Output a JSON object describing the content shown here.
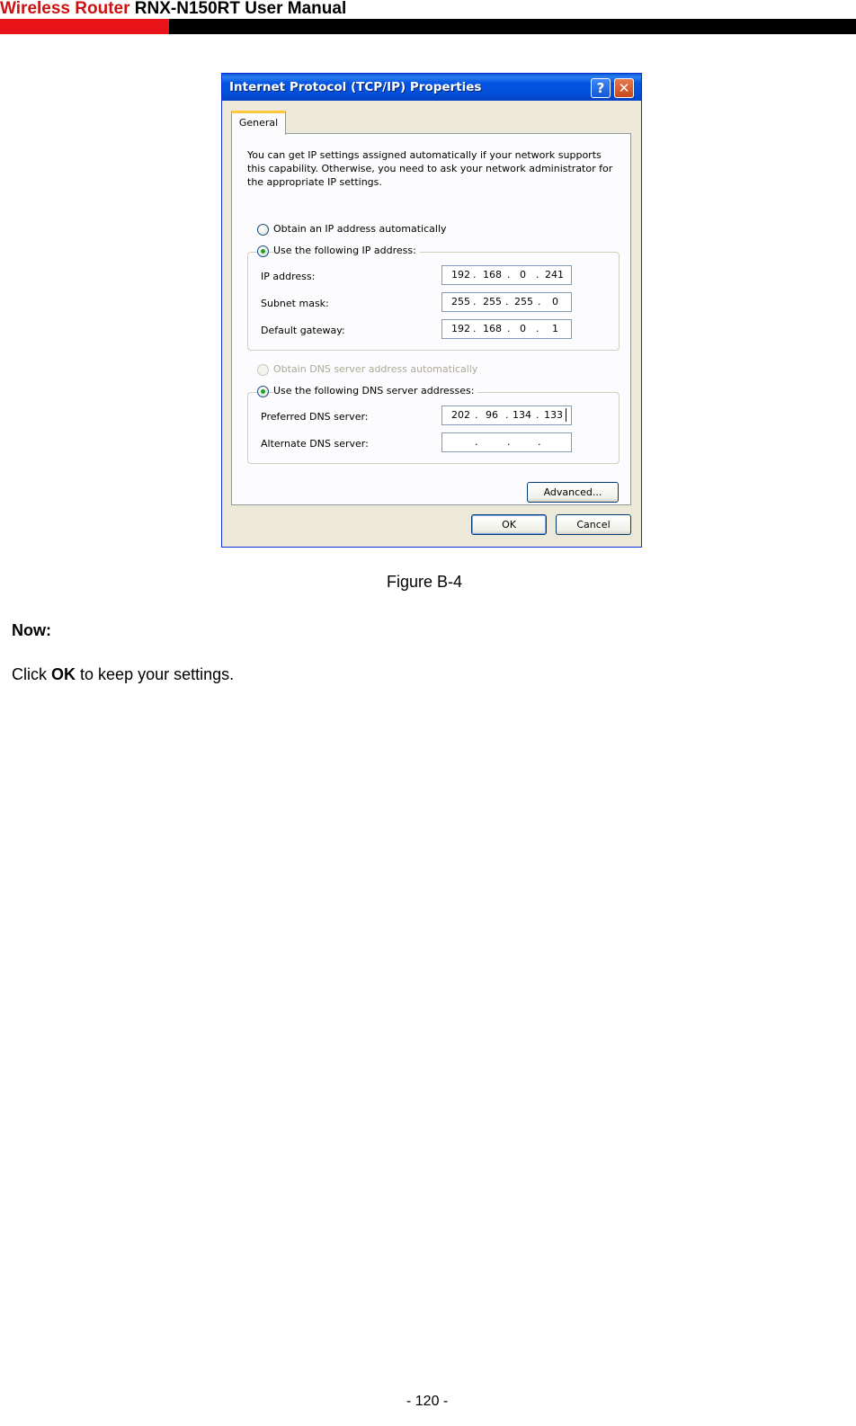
{
  "header": {
    "brand": "Wireless Router",
    "model": "RNX-N150RT User Manual",
    "accent_color": "#e8141a"
  },
  "dialog": {
    "title": "Internet Protocol (TCP/IP) Properties",
    "help_glyph": "?",
    "close_glyph": "✕",
    "tab_general": "General",
    "intro": "You can get IP settings assigned automatically if your network supports this capability. Otherwise, you need to ask your network administrator for the appropriate IP settings.",
    "radio_ip_auto": "Obtain an IP address automatically",
    "radio_ip_manual": "Use the following IP address:",
    "ip_label": "IP address:",
    "ip": [
      "192",
      "168",
      "0",
      "241"
    ],
    "mask_label": "Subnet mask:",
    "mask": [
      "255",
      "255",
      "255",
      "0"
    ],
    "gateway_label": "Default gateway:",
    "gateway": [
      "192",
      "168",
      "0",
      "1"
    ],
    "radio_dns_auto": "Obtain DNS server address automatically",
    "radio_dns_manual": "Use the following DNS server addresses:",
    "dns_pref_label": "Preferred DNS server:",
    "dns_pref": [
      "202",
      "96",
      "134",
      "133"
    ],
    "dns_alt_label": "Alternate DNS server:",
    "dns_alt": [
      "",
      "",
      "",
      ""
    ],
    "advanced_button": "Advanced...",
    "ok_button": "OK",
    "cancel_button": "Cancel",
    "titlebar_color": "#0454e3"
  },
  "content": {
    "caption": "Figure B-4",
    "now": "Now:",
    "click": "Click",
    "ok_bold": "OK",
    "rest": "to keep your settings."
  },
  "footer": {
    "page": "- 120 -"
  }
}
